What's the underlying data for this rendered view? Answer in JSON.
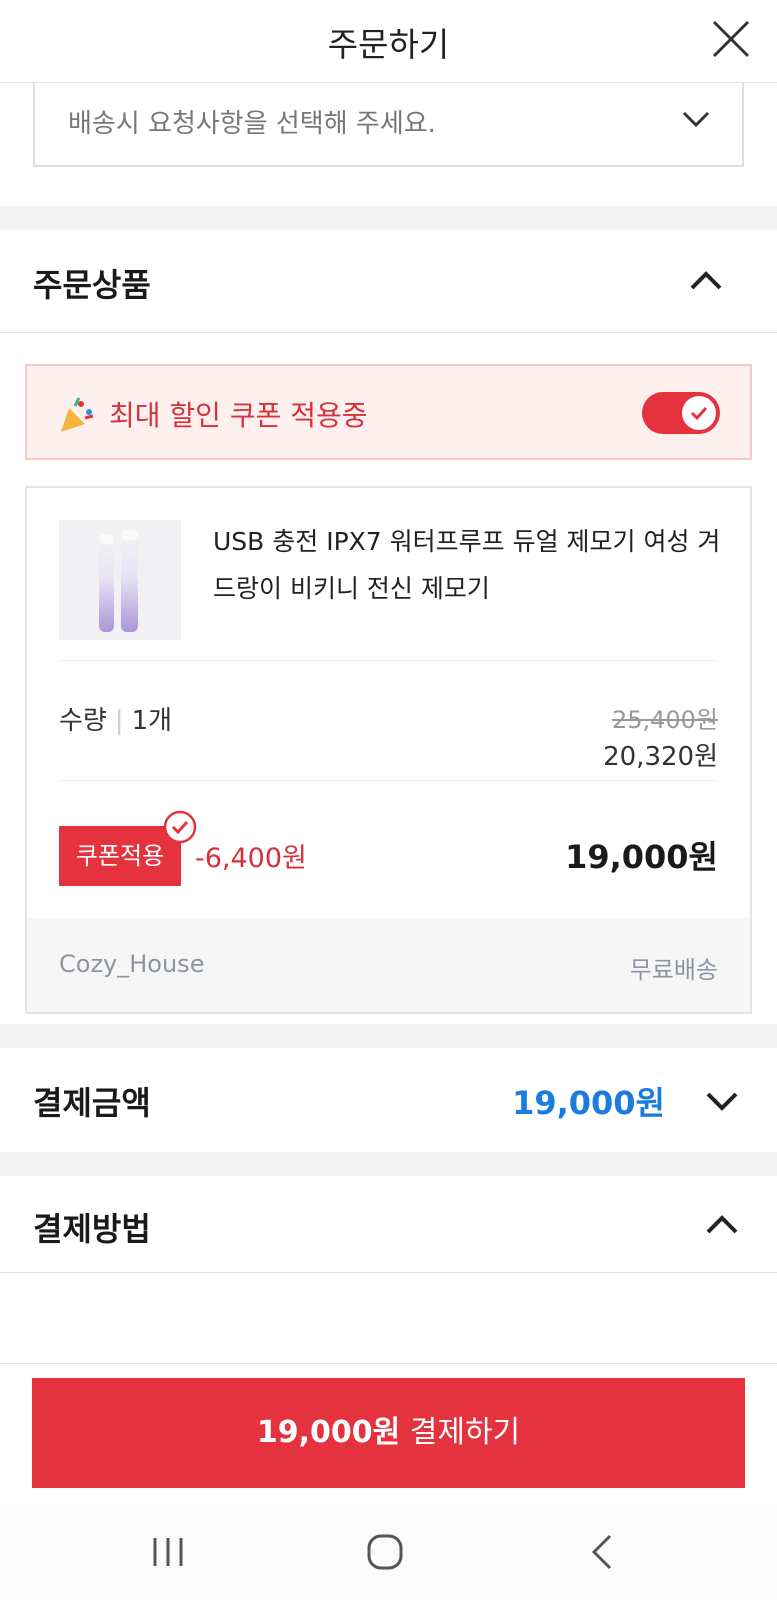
{
  "header": {
    "title": "주문하기",
    "close_icon": "close-icon"
  },
  "delivery": {
    "placeholder": "배송시 요청사항을 선택해 주세요.",
    "icon": "chevron-down-icon"
  },
  "order_items": {
    "title": "주문상품",
    "coupon_banner": {
      "emoji": "🎉",
      "text": "최대 할인 쿠폰 적용중",
      "toggle_on": true
    },
    "product": {
      "name": "USB 충전 IPX7 워터프루프 듀얼 제모기 여성 겨드랑이 비키니 전신 제모기",
      "quantity_label": "수량",
      "quantity_value": "1개",
      "original_price": "25,400원",
      "sale_price": "20,320원",
      "coupon_badge": "쿠폰적용",
      "discount": "-6,400원",
      "final_price": "19,000원",
      "seller": "Cozy_House",
      "shipping": "무료배송"
    }
  },
  "payment_amount": {
    "title": "결제금액",
    "value": "19,000원"
  },
  "payment_method": {
    "title": "결제방법"
  },
  "pay_button": {
    "amount": "19,000원",
    "label": " 결제하기"
  },
  "colors": {
    "accent_red": "#e5323f",
    "accent_blue": "#1a7be0",
    "banner_bg": "#fdf0ef"
  }
}
